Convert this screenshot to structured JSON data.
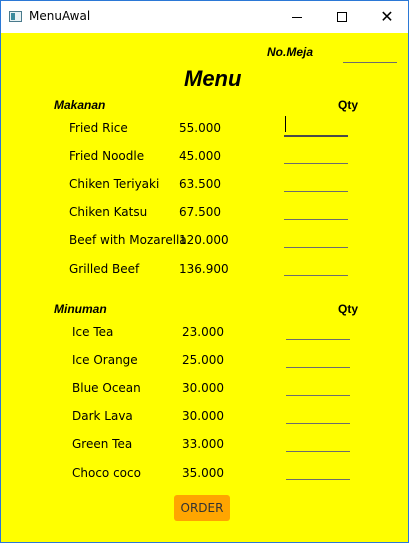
{
  "window": {
    "title": "MenuAwal"
  },
  "header": {
    "table_label": "No.Meja",
    "table_value": "",
    "menu_title": "Menu"
  },
  "food": {
    "section_label": "Makanan",
    "qty_label": "Qty",
    "items": [
      {
        "name": "Fried Rice",
        "price": "55.000",
        "qty": ""
      },
      {
        "name": "Fried Noodle",
        "price": "45.000",
        "qty": ""
      },
      {
        "name": "Chiken Teriyaki",
        "price": "63.500",
        "qty": ""
      },
      {
        "name": "Chiken Katsu",
        "price": "67.500",
        "qty": ""
      },
      {
        "name": "Beef with Mozarella",
        "price": "120.000",
        "qty": ""
      },
      {
        "name": "Grilled Beef",
        "price": "136.900",
        "qty": ""
      }
    ]
  },
  "drinks": {
    "section_label": "Minuman",
    "qty_label": "Qty",
    "items": [
      {
        "name": "Ice Tea",
        "price": "23.000",
        "qty": ""
      },
      {
        "name": "Ice Orange",
        "price": "25.000",
        "qty": ""
      },
      {
        "name": "Blue Ocean",
        "price": "30.000",
        "qty": ""
      },
      {
        "name": "Dark Lava",
        "price": "30.000",
        "qty": ""
      },
      {
        "name": "Green Tea",
        "price": "33.000",
        "qty": ""
      },
      {
        "name": "Choco coco",
        "price": "35.000",
        "qty": ""
      }
    ]
  },
  "order_button": {
    "label": "ORDER"
  },
  "colors": {
    "background": "#ffff00",
    "button": "#ffa500"
  }
}
